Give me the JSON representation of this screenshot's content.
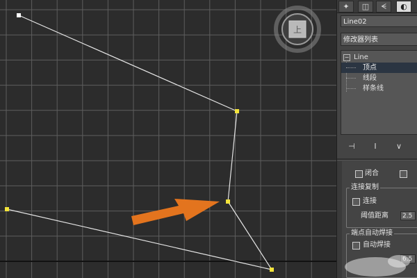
{
  "object_name": "Line02",
  "modifier_list": {
    "value": "修改器列表"
  },
  "stack": {
    "root": "Line",
    "items": [
      "顶点",
      "线段",
      "样条线"
    ],
    "selected_index": 0
  },
  "toolbar_icons": [
    "pin-stack-icon",
    "show-end-result-icon",
    "make-unique-icon"
  ],
  "panel_tabs": [
    "create-tab-icon",
    "modify-tab-icon",
    "hierarchy-tab-icon",
    "motion-tab-icon"
  ],
  "rollout": {
    "close_label": "闭合",
    "connect_copy_title": "连接复制",
    "connect_label": "连接",
    "threshold_label": "阈值距离",
    "threshold_value": "2.5",
    "endpoint_weld_title": "端点自动焊接",
    "auto_weld_label": "自动焊接",
    "weld_value": "6.5"
  },
  "viewcube": {
    "face_label": "上"
  },
  "colors": {
    "viewport_bg": "#2c2c2c",
    "grid": "#5e5e5e",
    "spline": "#e6e6e6",
    "vertex": "#f3e43a",
    "first_vertex": "#ffffff",
    "arrow": "#e3741e",
    "selected_row": "#2b3542"
  }
}
